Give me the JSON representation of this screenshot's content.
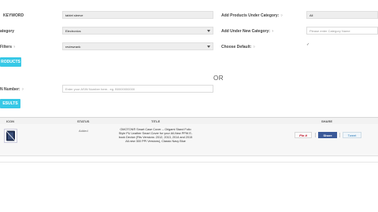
{
  "form": {
    "keyword_label": "KEYWORD",
    "keyword_value": "tablet sleeve",
    "category_label": "ategory",
    "category_value": "Electronics",
    "filters_label": "Filters",
    "filters_help": "?",
    "filters_value": "reviewrank",
    "add_under_category_label": "Add Products Under Category:",
    "add_under_category_help": "?",
    "add_under_category_value": "All",
    "add_new_category_label": "Add Under New Category:",
    "add_new_category_help": "?",
    "new_category_placeholder": "Please enter Category Name",
    "choose_default_label": "Choose Default:",
    "choose_default_help": "?",
    "choose_default_checked": "✓",
    "search_button_label": "RODUCTS"
  },
  "or_text": "OR",
  "asin": {
    "label": "N Number:",
    "help": "?",
    "placeholder": "Enter your ASIN Number here.. eg. B0000000000",
    "button_label": "ESULTS"
  },
  "table": {
    "columns": [
      "ICON",
      "STATUS",
      "TITLE",
      "SHARE"
    ],
    "rows": [
      {
        "status": "Added",
        "title": "OMOTON® Smart Case Cover -- Origami Stand Folio Style PU Leather Smart Cover for your All-New PPW E-book Device (Fits Versions: 2012, 2013, 2014 and 2015 All-new 300 PPI Versions), Classic Navy Blue",
        "share": {
          "pin_label": "Pin it",
          "fb_label": "Share",
          "tw_label": "Tweet"
        }
      }
    ]
  },
  "colors": {
    "accent": "#37c8e6",
    "facebook": "#3b5998",
    "pinterest": "#bd081c",
    "twitter": "#2b7bb9"
  }
}
